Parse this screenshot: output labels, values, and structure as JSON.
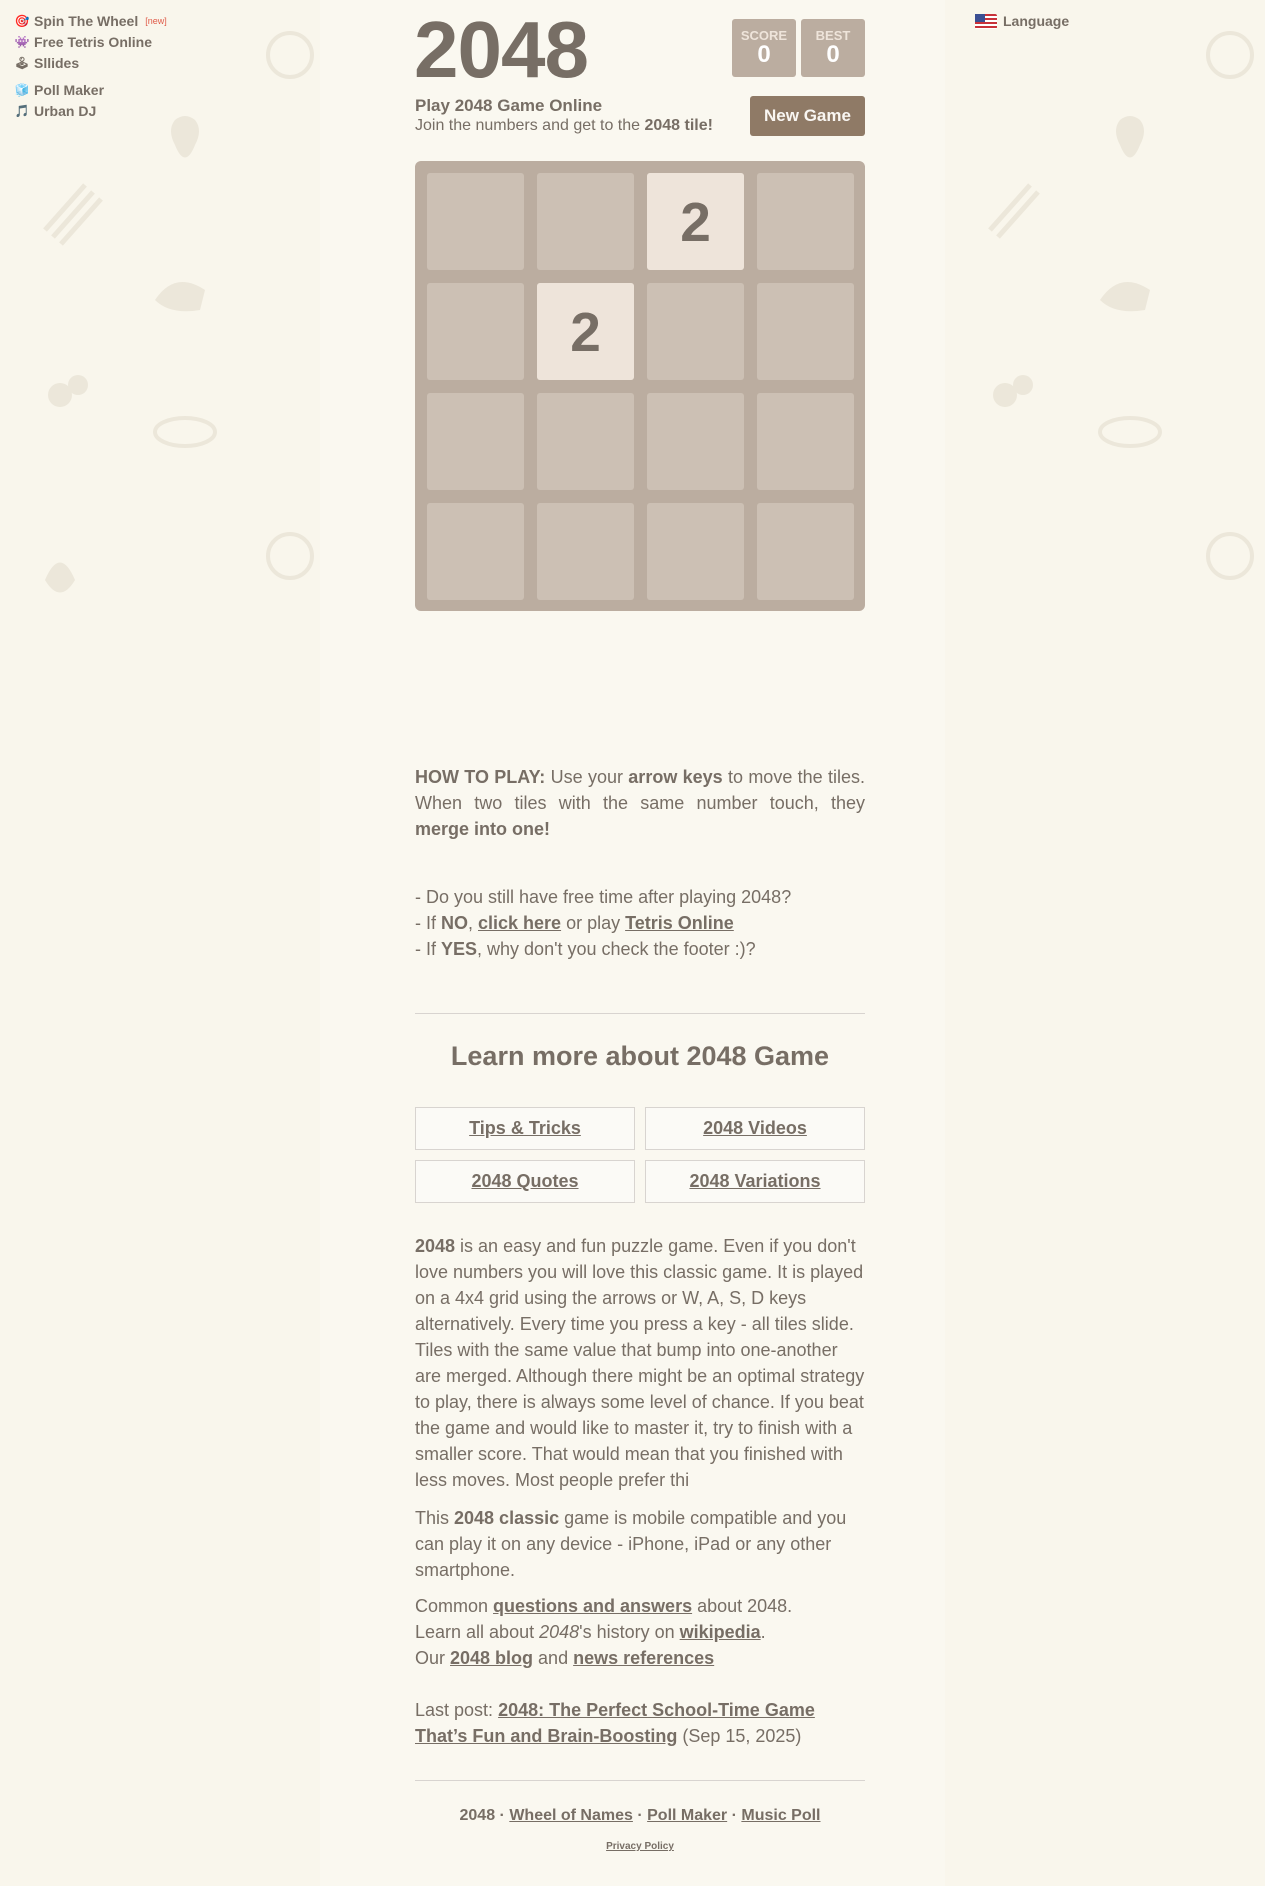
{
  "left_links": [
    {
      "icon": "target-icon",
      "glyph": "🎯",
      "label": "Spin The Wheel",
      "badge": "[new]"
    },
    {
      "icon": "alien-icon",
      "glyph": "👾",
      "label": "Free Tetris Online"
    },
    {
      "icon": "joystick-icon",
      "glyph": "🕹",
      "label": "Sllides"
    },
    {
      "icon": "cube-icon",
      "glyph": "🧊",
      "label": "Poll Maker"
    },
    {
      "icon": "music-note-icon",
      "glyph": "🎵",
      "label": "Urban DJ"
    }
  ],
  "language": {
    "label": "Language",
    "icon": "us-flag-icon"
  },
  "header": {
    "title": "2048",
    "score_label": "SCORE",
    "score_value": "0",
    "best_label": "BEST",
    "best_value": "0",
    "intro_title": "Play 2048 Game Online",
    "intro_sub_pre": "Join the numbers and get to the ",
    "intro_sub_bold": "2048 tile!",
    "new_game": "New Game"
  },
  "board": {
    "size": 4,
    "tiles": [
      {
        "row": 0,
        "col": 2,
        "value": "2"
      },
      {
        "row": 1,
        "col": 1,
        "value": "2"
      }
    ]
  },
  "how_to_play": {
    "label": "HOW TO PLAY:",
    "t1": " Use your ",
    "b1": "arrow keys",
    "t2": " to move the tiles. When two tiles with the same number touch, they ",
    "b2": "merge into one!"
  },
  "free_time": {
    "q": "- Do you still have free time after playing 2048?",
    "no_pre": "- If ",
    "no_bold": "NO",
    "no_mid": ", ",
    "no_link1": "click here",
    "no_mid2": " or play ",
    "no_link2": "Tetris Online",
    "yes_pre": "- If ",
    "yes_bold": "YES",
    "yes_post": ", why don't you check the footer :)?"
  },
  "learn": {
    "title": "Learn more about 2048 Game",
    "buttons": [
      "Tips & Tricks",
      "2048 Videos",
      "2048 Quotes",
      "2048 Variations"
    ]
  },
  "about": {
    "bold": "2048",
    "text": " is an easy and fun puzzle game. Even if you don't love numbers you will love this classic game. It is played on a 4x4 grid using the arrows or W, A, S, D keys alternatively. Every time you press a key - all tiles slide. Tiles with the same value that bump into one-another are merged. Although there might be an optimal strategy to play, there is always some level of chance. If you beat the game and would like to master it, try to finish with a smaller score. That would mean that you finished with less moves. Most people prefer thi",
    "mobile_pre": "This ",
    "mobile_bold": "2048 classic",
    "mobile_post": " game is mobile compatible and you can play it on any device - iPhone, iPad or any other smartphone.",
    "common_pre": "Common ",
    "common_link": "questions and answers",
    "common_post": " about 2048.",
    "learn_pre": "Learn all about ",
    "learn_em": "2048",
    "learn_mid": "'s history on ",
    "learn_link": "wikipedia",
    "learn_post": ".",
    "our_pre": "Our ",
    "our_link1": "2048 blog",
    "our_mid": " and ",
    "our_link2": "news references",
    "last_pre": "Last post: ",
    "last_link": "2048: The Perfect School-Time Game That’s Fun and Brain-Boosting",
    "last_date": " (Sep 15, 2025)"
  },
  "footer": {
    "item0": "2048",
    "links": [
      "Wheel of Names",
      "Poll Maker",
      "Music Poll"
    ],
    "sep": " · ",
    "privacy": "Privacy Policy"
  },
  "colors": {
    "board": "#bbada0",
    "tile_2": "#eee4da",
    "button": "#8f7a66",
    "text": "#776e65",
    "background": "#faf8f0"
  }
}
